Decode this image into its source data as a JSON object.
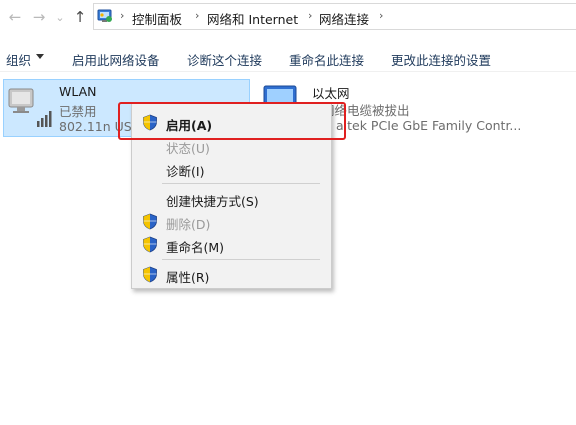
{
  "address": {
    "segments": [
      "控制面板",
      "网络和 Internet",
      "网络连接"
    ]
  },
  "toolbar": {
    "organize": "组织",
    "enable_device": "启用此网络设备",
    "diagnose": "诊断这个连接",
    "rename": "重命名此连接",
    "change_settings": "更改此连接的设置"
  },
  "connections": [
    {
      "name": "WLAN",
      "status": "已禁用",
      "device": "802.11n USB"
    },
    {
      "name": "以太网",
      "status": "网络电缆被拔出",
      "device": "altek PCIe GbE Family Contr..."
    }
  ],
  "context_menu": {
    "items": [
      {
        "label": "启用(A)",
        "state": "default",
        "shield": true
      },
      {
        "label": "状态(U)",
        "state": "disabled",
        "shield": false
      },
      {
        "label": "诊断(I)",
        "state": "normal",
        "shield": false
      },
      {
        "label": "创建快捷方式(S)",
        "state": "normal",
        "shield": false
      },
      {
        "label": "删除(D)",
        "state": "disabled",
        "shield": true
      },
      {
        "label": "重命名(M)",
        "state": "normal",
        "shield": true
      },
      {
        "label": "属性(R)",
        "state": "normal",
        "shield": true
      }
    ]
  },
  "colors": {
    "selection_bg": "#cce8ff",
    "highlight_box": "#e02020",
    "toolbar_text": "#1e395b"
  }
}
